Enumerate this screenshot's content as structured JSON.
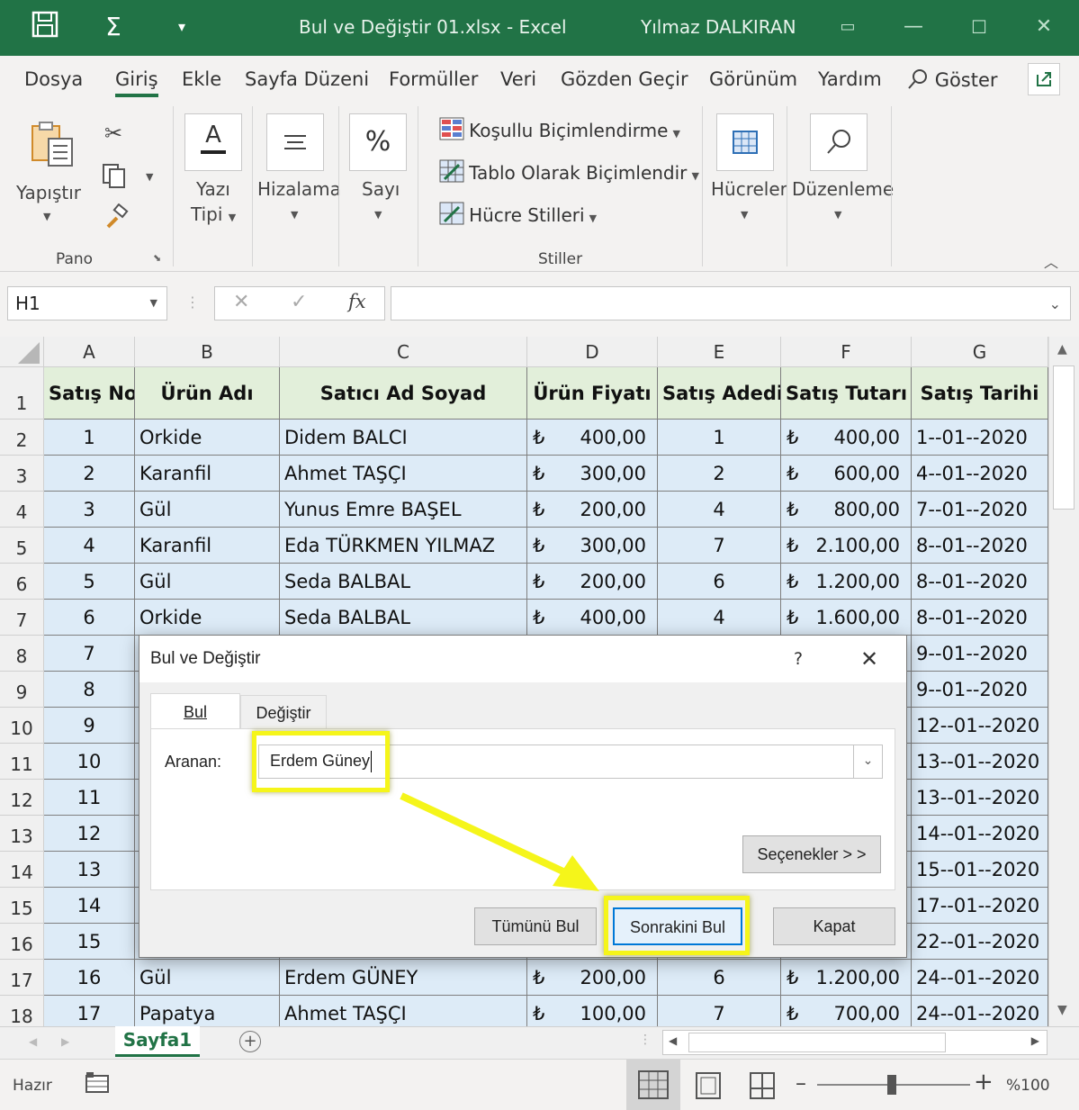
{
  "titlebar": {
    "title": "Bul ve Değiştir 01.xlsx  -  Excel",
    "user": "Yılmaz DALKIRAN",
    "save_icon": "save-icon",
    "autosum_icon": "sigma-icon"
  },
  "menu": {
    "items": [
      "Dosya",
      "Giriş",
      "Ekle",
      "Sayfa Düzeni",
      "Formüller",
      "Veri",
      "Gözden Geçir",
      "Görünüm",
      "Yardım",
      "Göster"
    ],
    "active": "Giriş"
  },
  "ribbon": {
    "paste_label": "Yapıştır",
    "clipboard_group": "Pano",
    "font_label_1": "Yazı",
    "font_label_2": "Tipi",
    "alignment_label": "Hizalama",
    "number_label": "Sayı",
    "conditional_formatting": "Koşullu Biçimlendirme",
    "format_as_table": "Tablo Olarak Biçimlendir",
    "cell_styles": "Hücre Stilleri",
    "styles_group": "Stiller",
    "cells_label": "Hücreler",
    "editing_label": "Düzenleme"
  },
  "formula_bar": {
    "name_box": "H1",
    "fx": "fx",
    "content": ""
  },
  "columns": [
    {
      "letter": "A",
      "header": "Satış No"
    },
    {
      "letter": "B",
      "header": "Ürün Adı"
    },
    {
      "letter": "C",
      "header": "Satıcı Ad Soyad"
    },
    {
      "letter": "D",
      "header": "Ürün Fiyatı"
    },
    {
      "letter": "E",
      "header": "Satış Adedi"
    },
    {
      "letter": "F",
      "header": "Satış Tutarı"
    },
    {
      "letter": "G",
      "header": "Satış Tarihi"
    }
  ],
  "rows": [
    {
      "row": "2",
      "no": "1",
      "product": "Orkide",
      "seller": "Didem BALCI",
      "price": "400,00",
      "qty": "1",
      "total": "400,00",
      "date": "1--01--2020"
    },
    {
      "row": "3",
      "no": "2",
      "product": "Karanfil",
      "seller": "Ahmet TAŞÇI",
      "price": "300,00",
      "qty": "2",
      "total": "600,00",
      "date": "4--01--2020"
    },
    {
      "row": "4",
      "no": "3",
      "product": "Gül",
      "seller": "Yunus Emre BAŞEL",
      "price": "200,00",
      "qty": "4",
      "total": "800,00",
      "date": "7--01--2020"
    },
    {
      "row": "5",
      "no": "4",
      "product": "Karanfil",
      "seller": "Eda TÜRKMEN YILMAZ",
      "price": "300,00",
      "qty": "7",
      "total": "2.100,00",
      "date": "8--01--2020"
    },
    {
      "row": "6",
      "no": "5",
      "product": "Gül",
      "seller": "Seda BALBAL",
      "price": "200,00",
      "qty": "6",
      "total": "1.200,00",
      "date": "8--01--2020"
    },
    {
      "row": "7",
      "no": "6",
      "product": "Orkide",
      "seller": "Seda BALBAL",
      "price": "400,00",
      "qty": "4",
      "total": "1.600,00",
      "date": "8--01--2020"
    },
    {
      "row": "8",
      "no": "7",
      "product": "",
      "seller": "",
      "price": "",
      "qty": "",
      "total": "",
      "date": "9--01--2020"
    },
    {
      "row": "9",
      "no": "8",
      "product": "",
      "seller": "",
      "price": "",
      "qty": "",
      "total": "",
      "date": "9--01--2020"
    },
    {
      "row": "10",
      "no": "9",
      "product": "",
      "seller": "",
      "price": "",
      "qty": "",
      "total": "",
      "date": "12--01--2020"
    },
    {
      "row": "11",
      "no": "10",
      "product": "",
      "seller": "",
      "price": "",
      "qty": "",
      "total": "",
      "date": "13--01--2020"
    },
    {
      "row": "12",
      "no": "11",
      "product": "",
      "seller": "",
      "price": "",
      "qty": "",
      "total": "",
      "date": "13--01--2020"
    },
    {
      "row": "13",
      "no": "12",
      "product": "",
      "seller": "",
      "price": "",
      "qty": "",
      "total": "",
      "date": "14--01--2020"
    },
    {
      "row": "14",
      "no": "13",
      "product": "",
      "seller": "",
      "price": "",
      "qty": "",
      "total": "",
      "date": "15--01--2020"
    },
    {
      "row": "15",
      "no": "14",
      "product": "",
      "seller": "",
      "price": "",
      "qty": "",
      "total": "",
      "date": "17--01--2020"
    },
    {
      "row": "16",
      "no": "15",
      "product": "",
      "seller": "",
      "price": "",
      "qty": "",
      "total": "",
      "date": "22--01--2020"
    },
    {
      "row": "17",
      "no": "16",
      "product": "Gül",
      "seller": "Erdem GÜNEY",
      "price": "200,00",
      "qty": "6",
      "total": "1.200,00",
      "date": "24--01--2020"
    },
    {
      "row": "18",
      "no": "17",
      "product": "Papatya",
      "seller": "Ahmet TAŞÇI",
      "price": "100,00",
      "qty": "7",
      "total": "700,00",
      "date": "24--01--2020"
    }
  ],
  "currency_symbol": "₺",
  "header_row_number": "1",
  "sheet_tab": "Sayfa1",
  "status": {
    "ready": "Hazır",
    "zoom": "%100"
  },
  "dialog": {
    "title": "Bul ve Değiştir",
    "help": "?",
    "tab_find": "Bul",
    "tab_replace": "Değiştir",
    "search_label": "Aranan:",
    "search_value": "Erdem Güney",
    "options_button": "Seçenekler > >",
    "find_all_button": "Tümünü Bul",
    "find_next_button": "Sonrakini Bul",
    "close_button": "Kapat"
  },
  "colors": {
    "excel_green": "#217346",
    "header_fill": "#e2efda",
    "data_fill": "#ddebf7",
    "highlight": "#f5f51a"
  }
}
